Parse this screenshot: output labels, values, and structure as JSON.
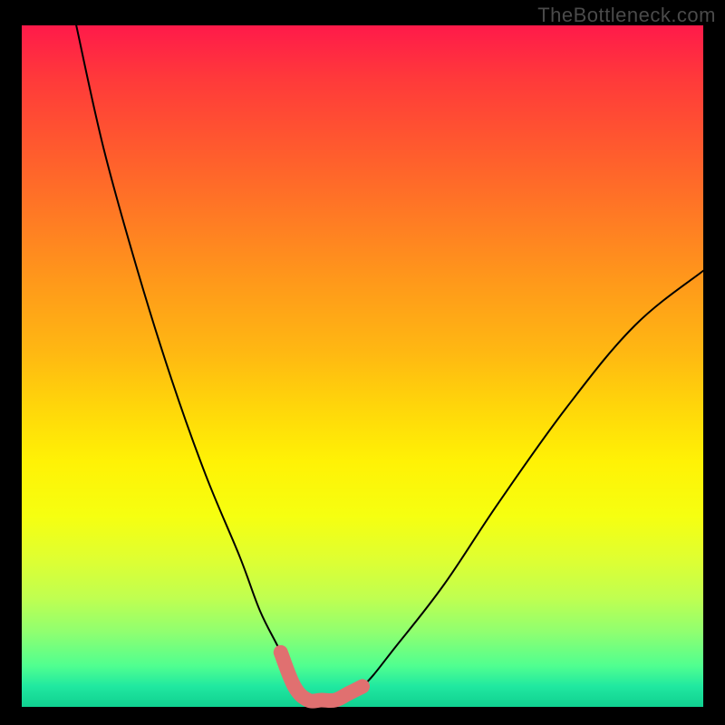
{
  "watermark": "TheBottleneck.com",
  "chart_data": {
    "type": "line",
    "title": "",
    "xlabel": "",
    "ylabel": "",
    "xlim": [
      0,
      100
    ],
    "ylim": [
      0,
      100
    ],
    "grid": false,
    "legend": false,
    "series": [
      {
        "name": "bottleneck-curve",
        "x": [
          8,
          12,
          17,
          22,
          27,
          32,
          35,
          38,
          40,
          42,
          46,
          50,
          55,
          62,
          70,
          80,
          90,
          100
        ],
        "values": [
          100,
          82,
          64,
          48,
          34,
          22,
          14,
          8,
          3,
          1,
          1,
          3,
          9,
          18,
          30,
          44,
          56,
          64
        ]
      }
    ],
    "highlight": {
      "name": "optimal-zone",
      "x": [
        38,
        40,
        42,
        44,
        46,
        48,
        50
      ],
      "values": [
        8,
        3,
        1,
        1,
        1,
        2,
        3
      ],
      "color": "#e07070"
    },
    "background_gradient": {
      "top": "#ff1a4a",
      "mid": "#fff205",
      "bottom": "#10d090"
    }
  }
}
